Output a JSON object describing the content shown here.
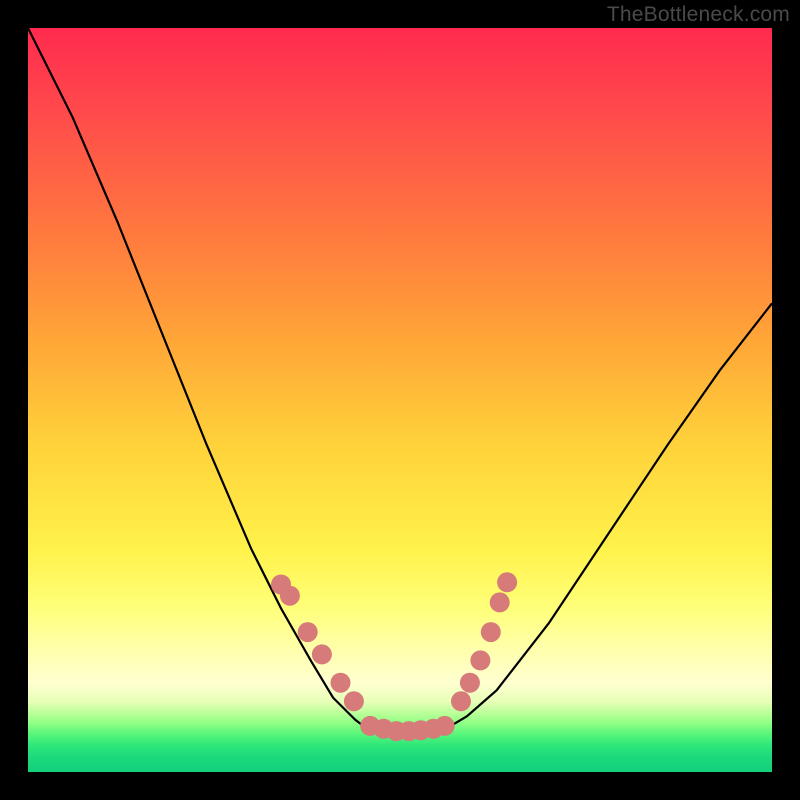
{
  "watermark": "TheBottleneck.com",
  "chart_data": {
    "type": "line",
    "title": "",
    "xlabel": "",
    "ylabel": "",
    "xlim": [
      0,
      1
    ],
    "ylim": [
      0,
      1
    ],
    "curve": {
      "left": {
        "x": [
          0.0,
          0.06,
          0.12,
          0.18,
          0.24,
          0.3,
          0.34,
          0.38,
          0.41,
          0.44,
          0.46
        ],
        "y": [
          1.0,
          0.88,
          0.74,
          0.59,
          0.44,
          0.3,
          0.22,
          0.15,
          0.1,
          0.07,
          0.055
        ]
      },
      "flat": {
        "x": [
          0.46,
          0.48,
          0.5,
          0.52,
          0.54,
          0.56
        ],
        "y": [
          0.055,
          0.053,
          0.052,
          0.052,
          0.053,
          0.057
        ]
      },
      "right": {
        "x": [
          0.56,
          0.59,
          0.63,
          0.7,
          0.78,
          0.86,
          0.93,
          1.0
        ],
        "y": [
          0.057,
          0.075,
          0.11,
          0.2,
          0.32,
          0.44,
          0.54,
          0.63
        ]
      }
    },
    "markers_left": [
      {
        "x": 0.34,
        "y": 0.252
      },
      {
        "x": 0.352,
        "y": 0.237
      },
      {
        "x": 0.376,
        "y": 0.188
      },
      {
        "x": 0.395,
        "y": 0.158
      },
      {
        "x": 0.42,
        "y": 0.12
      },
      {
        "x": 0.438,
        "y": 0.095
      }
    ],
    "markers_flat": [
      {
        "x": 0.46,
        "y": 0.062
      },
      {
        "x": 0.478,
        "y": 0.058
      },
      {
        "x": 0.495,
        "y": 0.055
      },
      {
        "x": 0.512,
        "y": 0.055
      },
      {
        "x": 0.528,
        "y": 0.056
      },
      {
        "x": 0.545,
        "y": 0.058
      },
      {
        "x": 0.56,
        "y": 0.062
      }
    ],
    "markers_right": [
      {
        "x": 0.582,
        "y": 0.095
      },
      {
        "x": 0.594,
        "y": 0.12
      },
      {
        "x": 0.608,
        "y": 0.15
      },
      {
        "x": 0.622,
        "y": 0.188
      },
      {
        "x": 0.634,
        "y": 0.228
      },
      {
        "x": 0.644,
        "y": 0.255
      }
    ]
  }
}
